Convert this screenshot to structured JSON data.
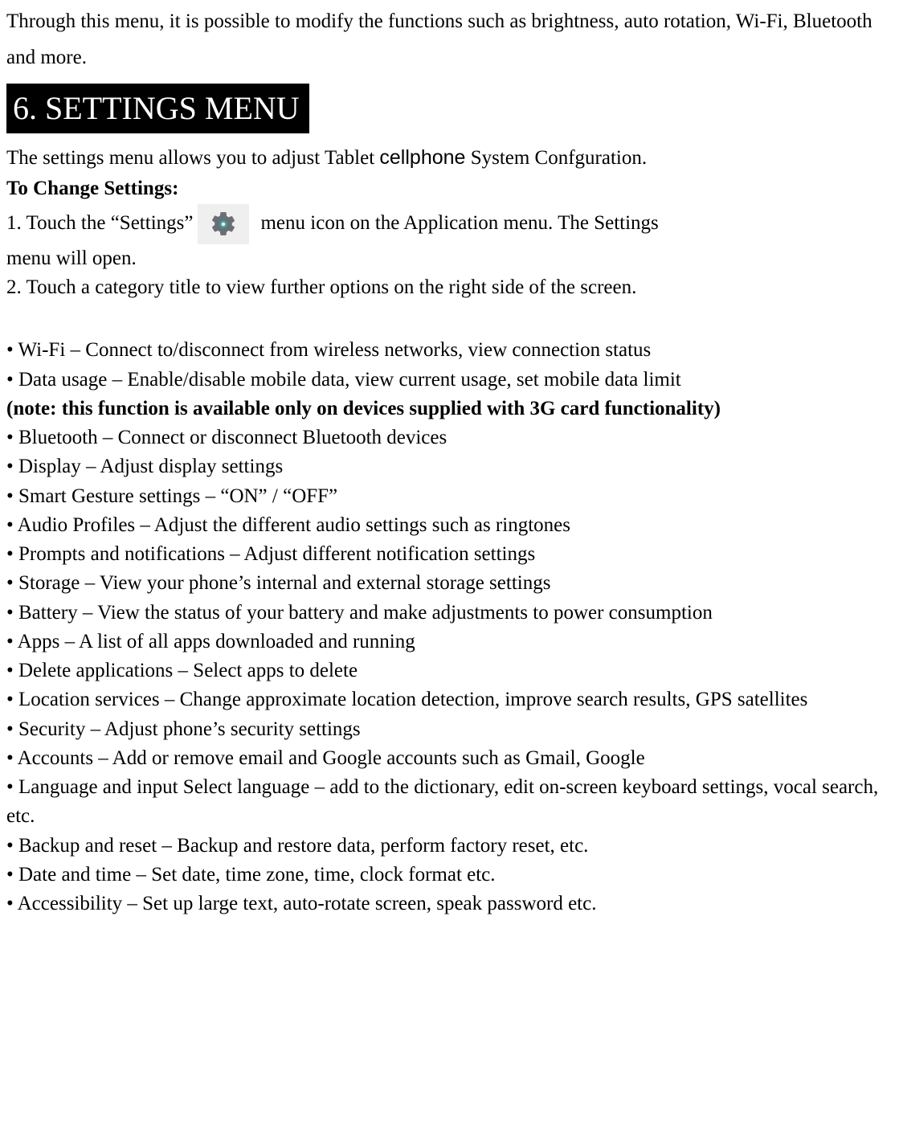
{
  "intro": "Through this menu, it is possible to modify the functions such as brightness, auto rotation, Wi-Fi, Bluetooth and more.",
  "heading": "6. SETTINGS MENU",
  "subdesc_before": "The settings menu allows you to adjust Tablet ",
  "subdesc_cell": "cellphone",
  "subdesc_after": " System Confguration.",
  "change_title": "To Change Settings:",
  "step1_a": "1. Touch the “Settings” ",
  "step1_b": " menu icon on the Application menu. The Settings",
  "step1_c": "menu will open.",
  "step2": "2. Touch a category title to view further options on the right side of the screen.",
  "bullets": {
    "wifi": "• Wi-Fi – Connect to/disconnect from wireless networks, view connection status",
    "data_usage": "• Data usage – Enable/disable mobile data, view current usage, set mobile data limit",
    "data_note": "(note: this function is available only on devices supplied with 3G card functionality)",
    "bluetooth": "• Bluetooth – Connect or disconnect Bluetooth devices",
    "display": "• Display – Adjust display settings",
    "smart_gesture": "• Smart Gesture settings – “ON” / “OFF”",
    "audio": "• Audio Profiles – Adjust the different audio settings such as ringtones",
    "prompts": "• Prompts and notifications – Adjust different notification settings",
    "storage": "• Storage – View your phone’s internal and external storage settings",
    "battery": "• Battery – View the status of your battery and make adjustments to power consumption",
    "apps": "• Apps – A list of all apps downloaded and running",
    "delete_apps": "• Delete applications – Select apps to delete",
    "location": "• Location services – Change approximate location detection, improve search results, GPS satellites",
    "security": "• Security – Adjust phone’s security settings",
    "accounts": "• Accounts – Add or remove email and Google accounts such as Gmail, Google",
    "language": "• Language and input Select language – add to the dictionary, edit on-screen keyboard settings, vocal search, etc.",
    "backup": "• Backup and reset – Backup and restore data, perform factory reset, etc.",
    "datetime": "• Date and time – Set date, time zone, time, clock format etc.",
    "accessibility": "• Accessibility – Set up large text, auto-rotate screen, speak password etc."
  }
}
